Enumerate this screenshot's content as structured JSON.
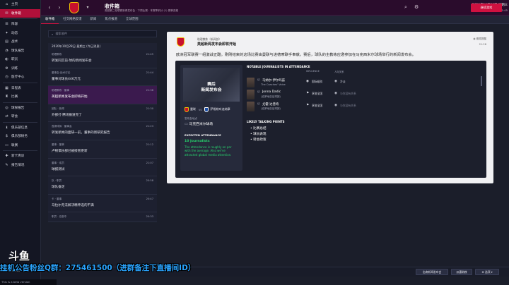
{
  "nav": {
    "items": [
      {
        "icon": "⌂",
        "label": "主页"
      },
      {
        "icon": "✉",
        "label": "收件箱",
        "active": true
      },
      {
        "icon": "☰",
        "label": "阵容"
      },
      {
        "icon": "✦",
        "label": "动态"
      },
      {
        "icon": "▤",
        "label": "战术"
      },
      {
        "icon": "◔",
        "label": "球队报告"
      },
      {
        "icon": "◐",
        "label": "职员"
      },
      {
        "icon": "⚙",
        "label": "训练"
      },
      {
        "icon": "◷",
        "label": "医疗中心"
      },
      {
        "icon": "▦",
        "label": "日程表"
      },
      {
        "icon": "♜",
        "label": "比赛"
      },
      {
        "icon": "◎",
        "label": "球探报告"
      },
      {
        "icon": "⇄",
        "label": "转会"
      },
      {
        "icon": "♝",
        "label": "俱乐部信息"
      },
      {
        "icon": "$",
        "label": "俱乐部财务"
      },
      {
        "icon": "▭",
        "label": "联赛"
      },
      {
        "icon": "✚",
        "label": "新卡青训"
      },
      {
        "icon": "✎",
        "label": "报告情况"
      }
    ]
  },
  "topbar": {
    "title": "收件箱",
    "subtitle": "英超第二轮联赛新闻发布会 · 下周比赛 · 本赛季积分 (1) 赛事进程",
    "date": "2020年10月28日 星期三",
    "time": "星期三 21:45",
    "continue": "继续游戏"
  },
  "tabs": [
    "收件箱",
    "社交网络反馈",
    "新闻",
    "焦点报道",
    "全球范围"
  ],
  "inbox": {
    "search_placeholder": "搜索收件",
    "date_header": "2020年10月28日 星期三 (今日消息)",
    "messages": [
      {
        "from": "助理教练",
        "subject": "转发同实前·球的新闻发布会",
        "time": "21:45"
      },
      {
        "from": "董事会·战术讨论",
        "subject": "董事对球员446万元",
        "time": "21:44"
      },
      {
        "from": "助理教练 · 董事",
        "subject": "英超新闻发布会即将开始",
        "time": "21:38",
        "active": true
      },
      {
        "from": "团队 · 新闻",
        "subject": "外部打·腾讯报道完了",
        "time": "21:30"
      },
      {
        "from": "首席球探 · 董事会",
        "subject": "转发新闻的面研一前，董事的新研究报告",
        "time": "21:23"
      },
      {
        "from": "董事 · 董事",
        "subject": "卢顿俱乐部已被接管更新",
        "time": "21:12"
      },
      {
        "from": "董事 · 成员",
        "subject": "球报测试",
        "time": "21:07"
      },
      {
        "from": "队 · 职员",
        "subject": "球队备足",
        "time": "20:58"
      },
      {
        "from": "卡 · 董事",
        "subject": "马拉尔无法解决精神选的不满",
        "time": "20:47"
      },
      {
        "from": "职员 · 总部中",
        "subject": "",
        "time": "20:33"
      }
    ]
  },
  "pane": {
    "from": "助理教练（新闻部）",
    "subject": "英超新闻发布会即将开始",
    "meta_right": "◉ 期限提醒",
    "time": "21:28",
    "body": "欧洲冠军联赛一组激战正酣。刚刚结束的这场比赛由曼联与进德摩联手奉献。赛后，球队的主教练应邀参加在马克西米尔球场举行的新闻发布会。",
    "promo": {
      "title1": "赛后",
      "title2": "新闻发布会",
      "home": "曼联",
      "vs": "vs",
      "away": "萨格勒布迪纳摩",
      "location_label": "发布会地点",
      "location": "马克西米尔球场",
      "expected_title": "EXPECTED ATTENDANCE",
      "expected_count": "10 Journalists",
      "expected_text": "The attendance is roughly on par with the average. Also we've attracted global media attention."
    },
    "journalists_title": "NOTABLE JOURNALISTS IN ATTENDANCE",
    "influence_header": "INFLUENCE",
    "attitude_header": "人际关系",
    "journalists": [
      {
        "pre": "记",
        "name": "马纳尔·伊尔玛兹",
        "outlet": "The Coaches' Voice",
        "influence_icon": "◉",
        "influence": "国际级别",
        "attitude_icon": "◉",
        "attitude": "冷淡"
      },
      {
        "pre": "记",
        "name": "Jonna Dadic",
        "outlet": "(克罗地亚足球报)",
        "influence_icon": "⚑",
        "influence": "享誉全国",
        "attitude_icon": "◉",
        "attitude": "与你没有关系"
      },
      {
        "pre": "记",
        "name": "尤霍·达普奇",
        "outlet": "(克罗地亚足球报)",
        "influence_icon": "⚑",
        "influence": "享誉全国",
        "attitude_icon": "◉",
        "attitude": "与你没有关系"
      }
    ],
    "talking_title": "LIKELY TALKING POINTS",
    "talking_points": [
      "比赛总结",
      "球员表现",
      "转会政策"
    ]
  },
  "bottom": {
    "btn1": "出席新闻发布会",
    "btn2": "派遣助教",
    "btn3": "⚙ 选项 ▾"
  },
  "overlay": {
    "text": "挂机公告粉丝Q群：275461500（进群备注下直播间ID）",
    "logo": "斗鱼",
    "logo_sub": "6686110",
    "footer": "This is a beta version"
  },
  "colors": {
    "accent": "#d01140",
    "topbar": "#2a0c2c",
    "nav": "#141623",
    "pane": "#f1f1f3",
    "green": "#27d36d"
  }
}
